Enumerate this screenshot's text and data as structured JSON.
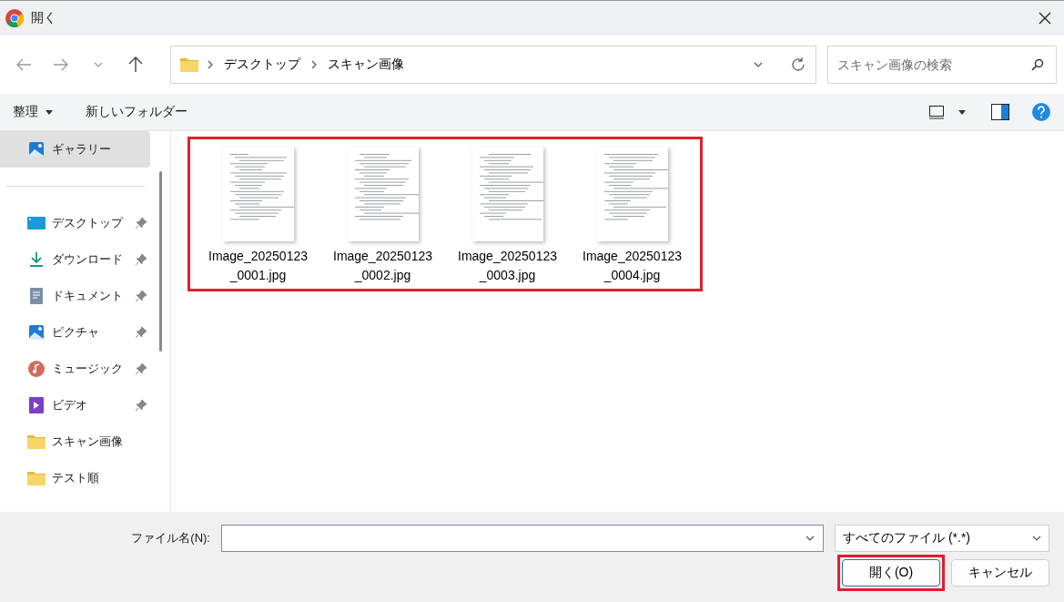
{
  "window": {
    "title": "開く"
  },
  "navigation": {
    "breadcrumb": [
      "デスクトップ",
      "スキャン画像"
    ],
    "search": {
      "placeholder": "スキャン画像の検索"
    }
  },
  "command_bar": {
    "organize": "整理",
    "new_folder": "新しいフォルダー"
  },
  "sidebar": {
    "items": [
      {
        "label": "ギャラリー",
        "kind": "gallery",
        "selected": true,
        "pinned": false
      },
      {
        "label": "デスクトップ",
        "kind": "desktop",
        "selected": false,
        "pinned": true
      },
      {
        "label": "ダウンロード",
        "kind": "download",
        "selected": false,
        "pinned": true
      },
      {
        "label": "ドキュメント",
        "kind": "document",
        "selected": false,
        "pinned": true
      },
      {
        "label": "ピクチャ",
        "kind": "pictures",
        "selected": false,
        "pinned": true
      },
      {
        "label": "ミュージック",
        "kind": "music",
        "selected": false,
        "pinned": true
      },
      {
        "label": "ビデオ",
        "kind": "video",
        "selected": false,
        "pinned": true
      },
      {
        "label": "スキャン画像",
        "kind": "folder",
        "selected": false,
        "pinned": false
      },
      {
        "label": "テスト順",
        "kind": "folder",
        "selected": false,
        "pinned": false
      }
    ]
  },
  "files": {
    "highlighted": true,
    "items": [
      {
        "name": "Image_20250123\n_0001.jpg",
        "kind": "picture"
      },
      {
        "name": "Image_20250123\n_0002.jpg",
        "kind": "picture"
      },
      {
        "name": "Image_20250123\n_0003.jpg",
        "kind": "picture"
      },
      {
        "name": "Image_20250123\n_0004.jpg",
        "kind": "picture"
      }
    ]
  },
  "footer": {
    "filename_label": "ファイル名(N):",
    "file_type": "すべてのファイル (*.*)",
    "open_button": {
      "label": "開く(O)",
      "highlighted": true
    },
    "cancel_button": "キャンセル"
  }
}
